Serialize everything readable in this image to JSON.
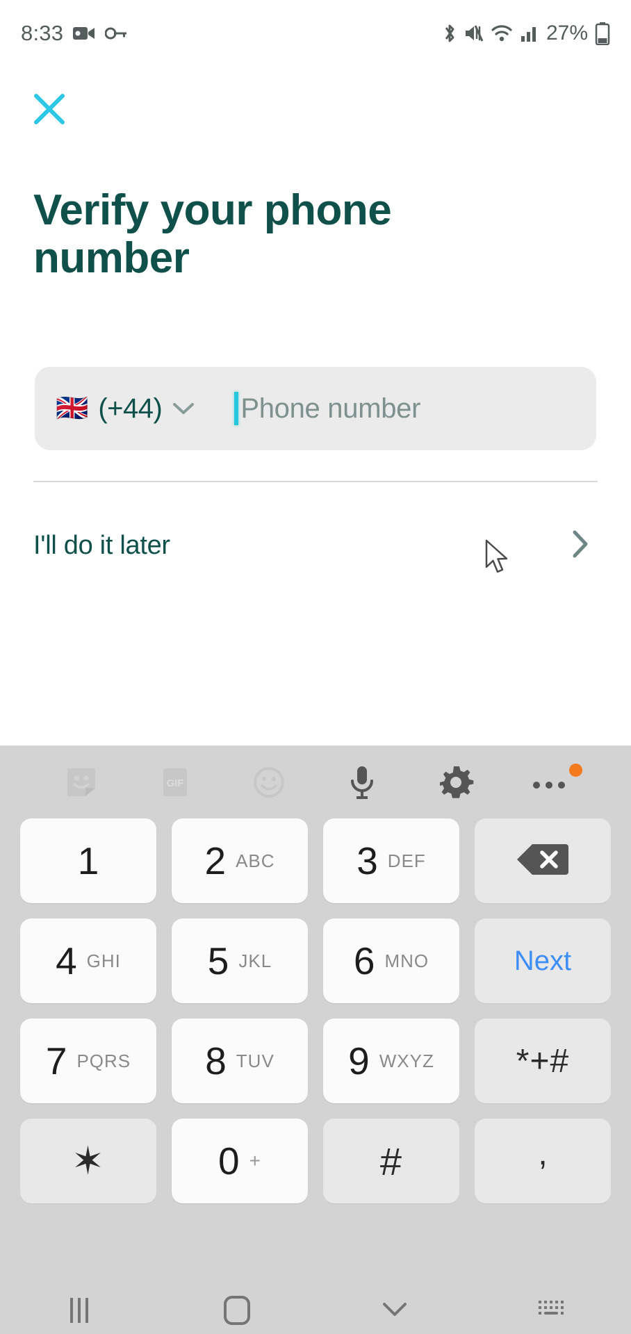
{
  "statusbar": {
    "time": "8:33",
    "left_icons": [
      "video-recording-icon",
      "key-icon"
    ],
    "right_icons": [
      "bluetooth-icon",
      "mute-icon",
      "wifi-icon",
      "signal-icon"
    ],
    "battery_text": "27%"
  },
  "header": {
    "close_icon": "close-icon",
    "close_color": "#2ec8e6",
    "title": "Verify your phone number",
    "title_color": "#10504a"
  },
  "phone_field": {
    "flag": "🇬🇧",
    "dial_code": "(+44)",
    "dropdown_icon": "chevron-down-icon",
    "placeholder": "Phone number",
    "value": "",
    "caret_color": "#26c6de",
    "background": "#ebebeb"
  },
  "later_row": {
    "label": "I'll do it later",
    "chevron_icon": "chevron-right-icon"
  },
  "keyboard": {
    "background": "#d3d3d3",
    "toolbar": [
      {
        "name": "sticker-icon",
        "label": ""
      },
      {
        "name": "gif-icon",
        "label": "GIF"
      },
      {
        "name": "emoji-icon",
        "label": ""
      },
      {
        "name": "microphone-icon",
        "label": ""
      },
      {
        "name": "settings-gear-icon",
        "label": ""
      },
      {
        "name": "more-options-icon",
        "label": "",
        "badge": true
      }
    ],
    "badge_color": "#f4791f",
    "next_key_color": "#3d8ef7",
    "rows": [
      [
        {
          "digit": "1",
          "letters": "",
          "type": "digit"
        },
        {
          "digit": "2",
          "letters": "ABC",
          "type": "digit"
        },
        {
          "digit": "3",
          "letters": "DEF",
          "type": "digit"
        },
        {
          "digit": "",
          "letters": "",
          "type": "backspace"
        }
      ],
      [
        {
          "digit": "4",
          "letters": "GHI",
          "type": "digit"
        },
        {
          "digit": "5",
          "letters": "JKL",
          "type": "digit"
        },
        {
          "digit": "6",
          "letters": "MNO",
          "type": "digit"
        },
        {
          "digit": "Next",
          "letters": "",
          "type": "next"
        }
      ],
      [
        {
          "digit": "7",
          "letters": "PQRS",
          "type": "digit"
        },
        {
          "digit": "8",
          "letters": "TUV",
          "type": "digit"
        },
        {
          "digit": "9",
          "letters": "WXYZ",
          "type": "digit"
        },
        {
          "digit": "*+#",
          "letters": "",
          "type": "symbols"
        }
      ],
      [
        {
          "digit": "✶",
          "letters": "",
          "type": "star"
        },
        {
          "digit": "0",
          "letters": "+",
          "type": "digit"
        },
        {
          "digit": "#",
          "letters": "",
          "type": "hash"
        },
        {
          "digit": ",",
          "letters": "",
          "type": "comma"
        }
      ]
    ]
  },
  "navbar": {
    "items": [
      "recents-icon",
      "home-icon",
      "hide-keyboard-icon",
      "keyboard-layout-icon"
    ]
  }
}
